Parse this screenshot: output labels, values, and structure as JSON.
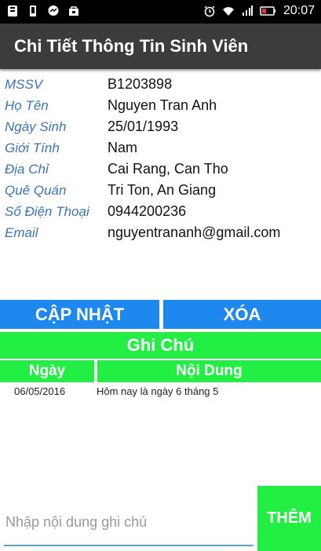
{
  "status_bar": {
    "left_icons": [
      "notification-icon",
      "phone-icon",
      "messenger-icon",
      "store-icon"
    ],
    "right_icons": [
      "alarm-icon",
      "wifi-icon",
      "signal-icon",
      "battery-icon"
    ],
    "time": "20:07"
  },
  "app_bar": {
    "title": "Chi Tiết Thông Tin Sinh Viên"
  },
  "student": {
    "fields": [
      {
        "label": "MSSV",
        "value": "B1203898"
      },
      {
        "label": "Họ Tên",
        "value": "Nguyen Tran Anh"
      },
      {
        "label": "Ngày Sinh",
        "value": "25/01/1993"
      },
      {
        "label": "Giới Tính",
        "value": "Nam"
      },
      {
        "label": "Địa Chỉ",
        "value": "Cai Rang, Can Tho"
      },
      {
        "label": "Quê Quán",
        "value": "Tri Ton, An Giang"
      },
      {
        "label": "Số Điện Thoại",
        "value": "0944200236"
      },
      {
        "label": "Email",
        "value": "nguyentrananh@gmail.com"
      }
    ]
  },
  "actions": {
    "update_label": "CẬP NHẬT",
    "delete_label": "XÓA"
  },
  "notes": {
    "title": "Ghi Chú",
    "columns": {
      "date": "Ngày",
      "content": "Nội Dung"
    },
    "rows": [
      {
        "date": "06/05/2016",
        "content": "Hôm nay là ngày 6 tháng 5"
      }
    ]
  },
  "note_input": {
    "placeholder": "Nhập nội dung ghi chú",
    "value": ""
  },
  "add_button": {
    "label": "THÊM"
  },
  "colors": {
    "blue_button": "#1e88ee",
    "green": "#22ee44",
    "label_blue": "#3a73b8",
    "app_bar": "#3c3c3c"
  }
}
